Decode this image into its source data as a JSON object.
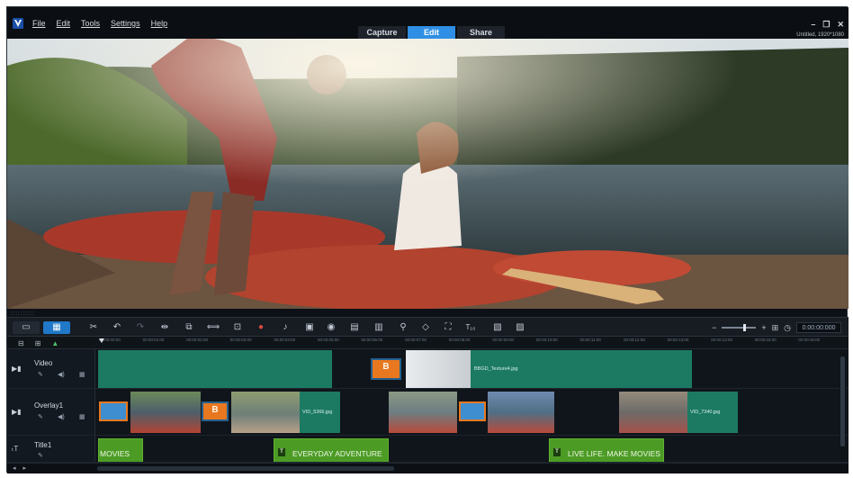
{
  "colors": {
    "accent": "#2f8fe4",
    "video_clip": "#1c7a63",
    "title_clip": "#4c9b25",
    "background": "#0d1117"
  },
  "app": {
    "logo_icon": "v-logo-icon"
  },
  "menu": [
    "File",
    "Edit",
    "Tools",
    "Settings",
    "Help"
  ],
  "mode_tabs": [
    {
      "label": "Capture",
      "active": false
    },
    {
      "label": "Edit",
      "active": true
    },
    {
      "label": "Share",
      "active": false
    }
  ],
  "window_controls": {
    "minimize": "–",
    "restore": "❐",
    "close": "✕"
  },
  "project_info": "Untitled, 1920*1080",
  "toolbar": {
    "icons": [
      "timeline-view-icon",
      "storyboard-view-icon",
      "tools-icon",
      "undo-icon",
      "redo-icon",
      "split-icon",
      "crop-icon",
      "stretch-icon",
      "fit-icon",
      "record-icon",
      "audio-icon",
      "multicam-icon",
      "motion-icon",
      "pan-zoom-icon",
      "mask-icon",
      "color-icon",
      "path-icon",
      "mask-creator-icon",
      "title-icon",
      "subtitle-icon",
      "time-remap-icon"
    ],
    "timecode": "0:00:00:000"
  },
  "ruler": {
    "labels": [
      "00:00:00:00",
      "00:00:01:00",
      "00:00:02:00",
      "00:00:03:00",
      "00:00:04:00",
      "00:00:05:00",
      "00:00:06:00",
      "00:00:07:00",
      "00:00:08:00",
      "00:00:09:00",
      "00:00:10:00",
      "00:00:11:00",
      "00:00:12:00",
      "00:00:13:00",
      "00:00:14:00",
      "00:00:15:00",
      "00:00:16:00"
    ]
  },
  "tracks": {
    "video": {
      "name": "Video",
      "clips": [
        {
          "label": "BBGD_Texture4.jpg"
        }
      ]
    },
    "overlay": {
      "name": "Overlay1",
      "clips": [
        {
          "label": "VID_5366.jpg"
        },
        {
          "label": "VID_7340.jpg"
        }
      ]
    },
    "title": {
      "name": "Title1",
      "clips": [
        {
          "label": "MOVIES"
        },
        {
          "label": "EVERYDAY ADVENTURE"
        },
        {
          "label": "LIVE LIFE. MAKE MOVIES"
        }
      ]
    }
  },
  "thumb_badge": "B"
}
